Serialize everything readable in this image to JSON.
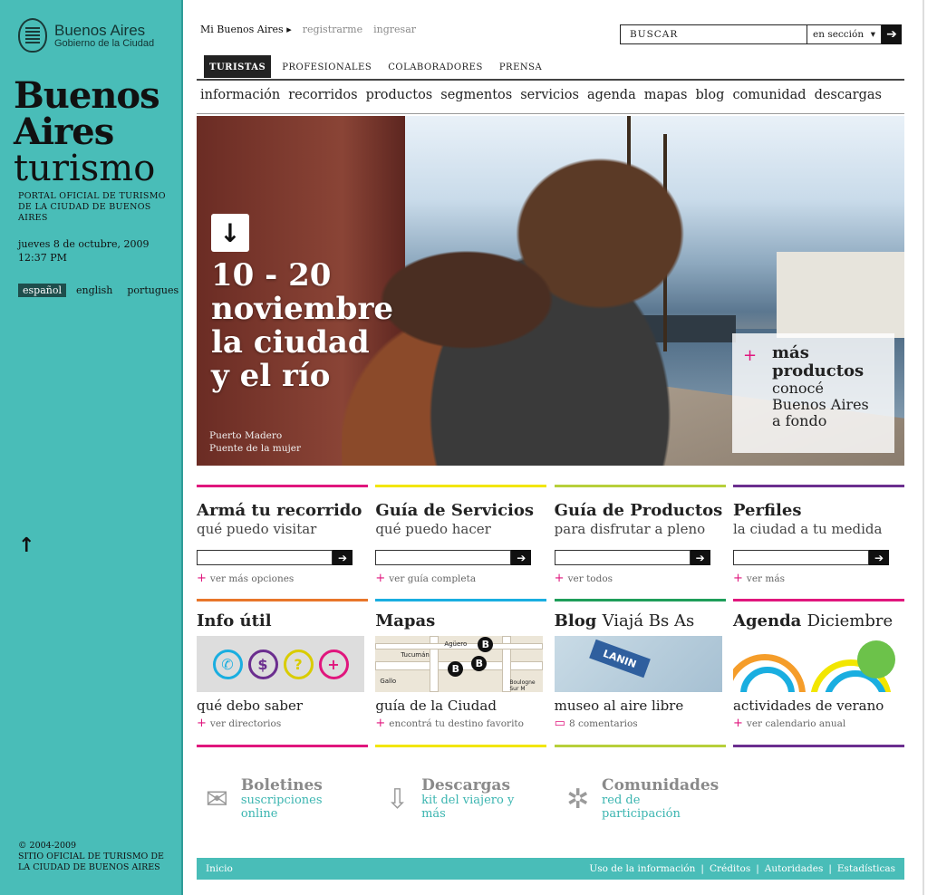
{
  "sidebar": {
    "logo_line1": "Buenos Aires",
    "logo_line2": "Gobierno de la Ciudad",
    "brand_line1": "Buenos",
    "brand_line2": "Aires",
    "brand_line3": "turismo",
    "tagline": "PORTAL OFICIAL DE TURISMO DE LA CIUDAD DE BUENOS AIRES",
    "date": "jueves 8 de octubre, 2009",
    "time": "12:37 PM",
    "languages": [
      "español",
      "english",
      "portugues"
    ],
    "active_language": "español",
    "copyright": "© 2004-2009",
    "copyright_text": "SITIO OFICIAL DE TURISMO DE LA CIUDAD DE BUENOS AIRES"
  },
  "header": {
    "mi_ba": "Mi Buenos Aires",
    "register": "registrarme",
    "login": "ingresar",
    "search_placeholder": "BUSCAR",
    "search_scope": "en sección"
  },
  "tabs": [
    "TURISTAS",
    "PROFESIONALES",
    "COLABORADORES",
    "PRENSA"
  ],
  "nav": [
    "información",
    "recorridos",
    "productos",
    "segmentos",
    "servicios",
    "agenda",
    "mapas",
    "blog",
    "comunidad",
    "descargas"
  ],
  "hero": {
    "headline": [
      "10 - 20",
      "noviembre",
      "la ciudad",
      "y el río"
    ],
    "caption1": "Puerto Madero",
    "caption2": "Puente de la mujer",
    "more_title1": "más",
    "more_title2": "productos",
    "more_sub": [
      "conocé",
      "Buenos Aires",
      "a fondo"
    ]
  },
  "cards": [
    {
      "title": "Armá tu recorrido",
      "sub": "qué puedo visitar",
      "link": "ver más opciones",
      "color": "#e0167d"
    },
    {
      "title": "Guía de Servicios",
      "sub": "qué puedo hacer",
      "link": "ver guía completa",
      "color": "#f2e600"
    },
    {
      "title": "Guía de Productos",
      "sub": "para disfrutar a pleno",
      "link": "ver todos",
      "color": "#b7cf3a"
    },
    {
      "title": "Perfiles",
      "sub": "la ciudad a tu medida",
      "link": "ver más",
      "color": "#6b2e8f"
    }
  ],
  "cards2": [
    {
      "title": "Info útil",
      "extra": "",
      "caption": "qué debo saber",
      "link": "ver directorios",
      "color": "#e8762a"
    },
    {
      "title": "Mapas",
      "extra": "",
      "caption": "guía de la Ciudad",
      "link": "encontrá tu destino favorito",
      "color": "#1aaee0"
    },
    {
      "title": "Blog",
      "extra": "Viajá Bs As",
      "caption": "museo al aire libre",
      "link": "8 comentarios",
      "color": "#1e9e5a"
    },
    {
      "title": "Agenda",
      "extra": "Diciembre",
      "caption": "actividades de verano",
      "link": "ver calendario anual",
      "color": "#e0167d"
    }
  ],
  "map_labels": [
    "Tucumán",
    "Agüero",
    "Gallo",
    "Boulogne Sur M"
  ],
  "sign_text": "LANIN",
  "bottom_colors": [
    "#e0167d",
    "#f2e600",
    "#b7cf3a",
    "#6b2e8f"
  ],
  "extras": [
    {
      "title": "Boletines",
      "sub": "suscripciones online",
      "icon": "envelope-icon"
    },
    {
      "title": "Descargas",
      "sub": "kit del viajero y más",
      "icon": "download-icon"
    },
    {
      "title": "Comunidades",
      "sub": "red de participación",
      "icon": "network-icon"
    }
  ],
  "footer": {
    "home": "Inicio",
    "links": [
      "Uso de la información",
      "Créditos",
      "Autoridades",
      "Estadísticas"
    ]
  }
}
